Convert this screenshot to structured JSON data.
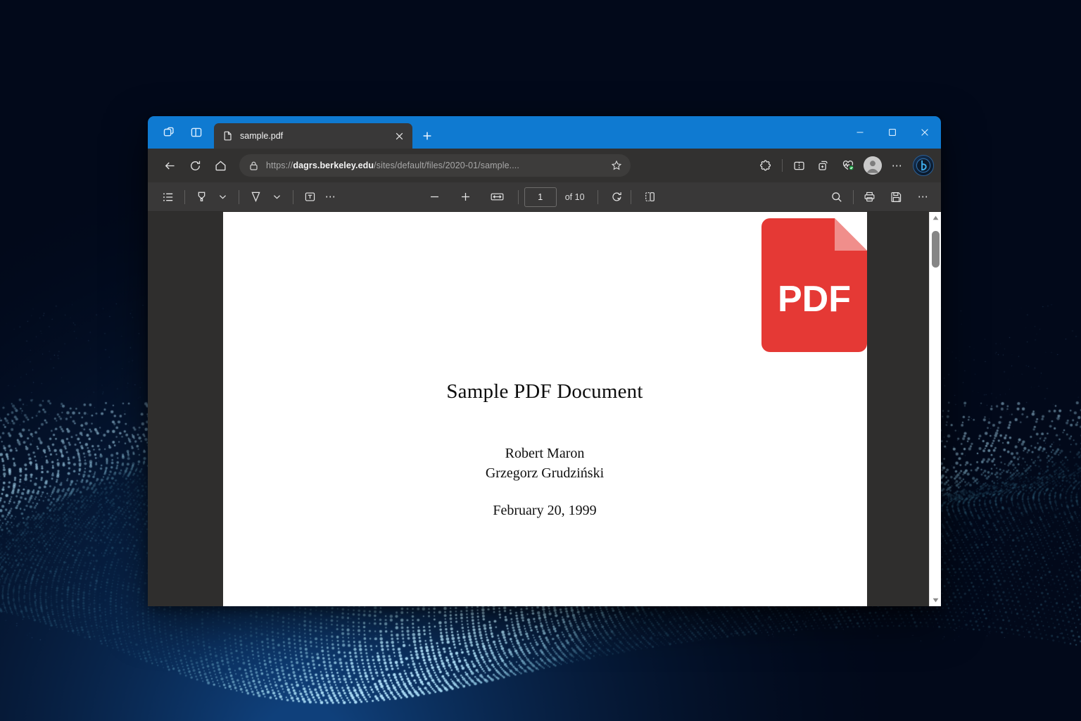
{
  "desktop": {
    "wallpaper_name": "blue-particle-wave-wallpaper"
  },
  "browser": {
    "tabstrip": {
      "tab_actions_label": "Tab actions",
      "copilot_pane_label": "Copilot",
      "split_screen_label": "Split screen",
      "tabs": [
        {
          "title": "sample.pdf",
          "favicon": "document-icon",
          "active": true,
          "close_label": "×"
        }
      ],
      "new_tab_label": "+",
      "window_controls": {
        "minimize": "—",
        "maximize": "□",
        "close": "✕"
      },
      "accent_color": "#0f7ad1"
    },
    "navbar": {
      "back_label": "Back",
      "refresh_label": "Refresh",
      "home_label": "Home",
      "lock_icon": "lock-icon",
      "url_scheme": "https://",
      "url_domain": "dagrs.berkeley.edu",
      "url_path": "/sites/default/files/2020-01/sample....",
      "url_full": "https://dagrs.berkeley.edu/sites/default/files/2020-01/sample....",
      "favorite_label": "Add this page to favorites",
      "right_buttons": [
        {
          "name": "extensions-icon",
          "label": "Extensions"
        },
        {
          "name": "split-screen-icon",
          "label": "Split screen"
        },
        {
          "name": "collections-icon",
          "label": "Collections"
        },
        {
          "name": "shopping-health-icon",
          "label": "Browser essentials"
        },
        {
          "name": "profile-avatar",
          "label": "Profile"
        },
        {
          "name": "settings-more-icon",
          "label": "Settings and more"
        },
        {
          "name": "copilot-icon",
          "label": "Copilot"
        }
      ]
    },
    "pdf_toolbar": {
      "left_tools": [
        {
          "name": "table-of-contents-icon",
          "label": "Table of contents"
        },
        {
          "name": "highlighter-icon",
          "label": "Highlight"
        },
        {
          "name": "highlighter-chevron",
          "label": "Highlight options"
        },
        {
          "name": "eraser-icon",
          "label": "Erase"
        },
        {
          "name": "eraser-chevron",
          "label": "Erase options"
        },
        {
          "name": "add-text-icon",
          "label": "Add text"
        },
        {
          "name": "more-tools-icon",
          "label": "More tools"
        }
      ],
      "zoom_out_label": "−",
      "zoom_in_label": "+",
      "fit_page_label": "Fit to page",
      "page_number": "1",
      "page_total": "of 10",
      "rotate_label": "Rotate",
      "page_view_label": "Page view",
      "right_tools": [
        {
          "name": "search-icon",
          "label": "Search"
        },
        {
          "name": "print-icon",
          "label": "Print"
        },
        {
          "name": "save-icon",
          "label": "Save"
        },
        {
          "name": "more-options-icon",
          "label": "More options"
        }
      ]
    },
    "scrollbar": {
      "up_arrow": "▲",
      "down_arrow": "▼",
      "name": "vertical-scrollbar"
    }
  },
  "document": {
    "badge_text": "PDF",
    "badge_color": "#e53935",
    "title": "Sample PDF Document",
    "authors": [
      "Robert Maron",
      "Grzegorz Grudziński"
    ],
    "date": "February 20, 1999"
  }
}
